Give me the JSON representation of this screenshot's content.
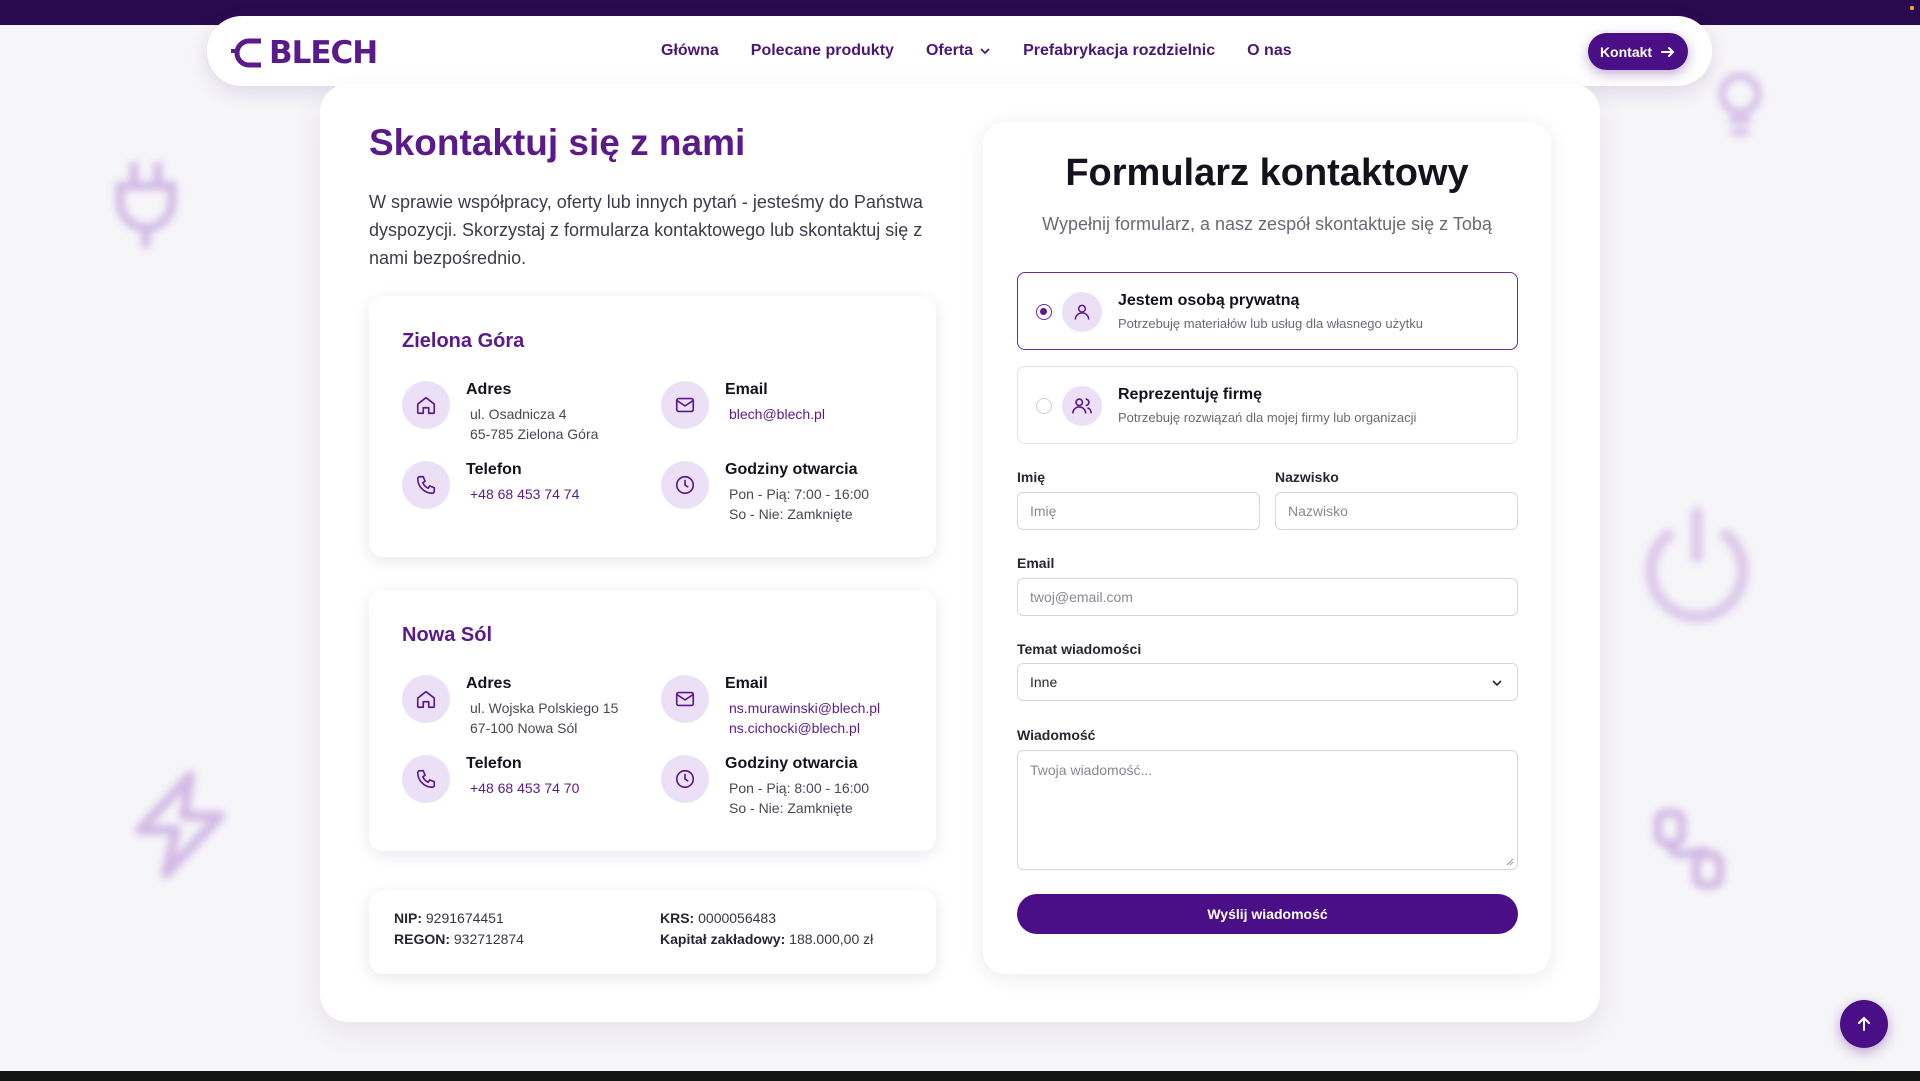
{
  "nav": {
    "logo_text": "BLECH",
    "links": [
      "Główna",
      "Polecane produkty",
      "Oferta",
      "Prefabrykacja rozdzielnic",
      "O nas"
    ],
    "cta_label": "Kontakt"
  },
  "contact": {
    "title": "Skontaktuj się z nami",
    "intro": "W sprawie współpracy, oferty lub innych pytań - jesteśmy do Państwa dyspozycji. Skorzystaj z formularza kontaktowego lub skontaktuj się z nami bezpośrednio.",
    "offices": [
      {
        "name": "Zielona Góra",
        "address_label": "Adres",
        "address_line1": "ul. Osadnicza 4",
        "address_line2": "65-785 Zielona Góra",
        "email_label": "Email",
        "email1": "blech@blech.pl",
        "email2": "",
        "phone_label": "Telefon",
        "phone": "+48 68 453 74 74",
        "hours_label": "Godziny otwarcia",
        "hours_line1": "Pon - Pią: 7:00 - 16:00",
        "hours_line2": "So - Nie: Zamknięte"
      },
      {
        "name": "Nowa Sól",
        "address_label": "Adres",
        "address_line1": "ul. Wojska Polskiego 15",
        "address_line2": "67-100 Nowa Sól",
        "email_label": "Email",
        "email1": "ns.murawinski@blech.pl",
        "email2": "ns.cichocki@blech.pl",
        "phone_label": "Telefon",
        "phone": "+48 68 453 74 70",
        "hours_label": "Godziny otwarcia",
        "hours_line1": "Pon - Pią: 8:00 - 16:00",
        "hours_line2": "So - Nie: Zamknięte"
      }
    ],
    "legal": {
      "nip_label": "NIP:",
      "nip": "9291674451",
      "regon_label": "REGON:",
      "regon": "932712874",
      "krs_label": "KRS:",
      "krs": "0000056483",
      "capital_label": "Kapitał zakładowy:",
      "capital": "188.000,00 zł"
    }
  },
  "form": {
    "title": "Formularz kontaktowy",
    "subtitle": "Wypełnij formularz, a nasz zespół skontaktuje się z Tobą",
    "choices": [
      {
        "title": "Jestem osobą prywatną",
        "desc": "Potrzebuję materiałów lub usług dla własnego użytku",
        "selected": true
      },
      {
        "title": "Reprezentuję firmę",
        "desc": "Potrzebuję rozwiązań dla mojej firmy lub organizacji",
        "selected": false
      }
    ],
    "first_name_label": "Imię",
    "first_name_placeholder": "Imię",
    "last_name_label": "Nazwisko",
    "last_name_placeholder": "Nazwisko",
    "email_label": "Email",
    "email_placeholder": "twoj@email.com",
    "topic_label": "Temat wiadomości",
    "topic_value": "Inne",
    "message_label": "Wiadomość",
    "message_placeholder": "Twoja wiadomość...",
    "submit_label": "Wyślij wiadomość"
  },
  "colors": {
    "brand": "#5b1a8c",
    "button": "#4a0f87",
    "icon_bg": "#ece0f6",
    "topbar": "#2a0a4e"
  },
  "icons": [
    "home-icon",
    "mail-icon",
    "phone-icon",
    "clock-icon",
    "user-icon",
    "users-icon",
    "chevron-down-icon",
    "arrow-right-icon",
    "arrow-up-icon"
  ]
}
